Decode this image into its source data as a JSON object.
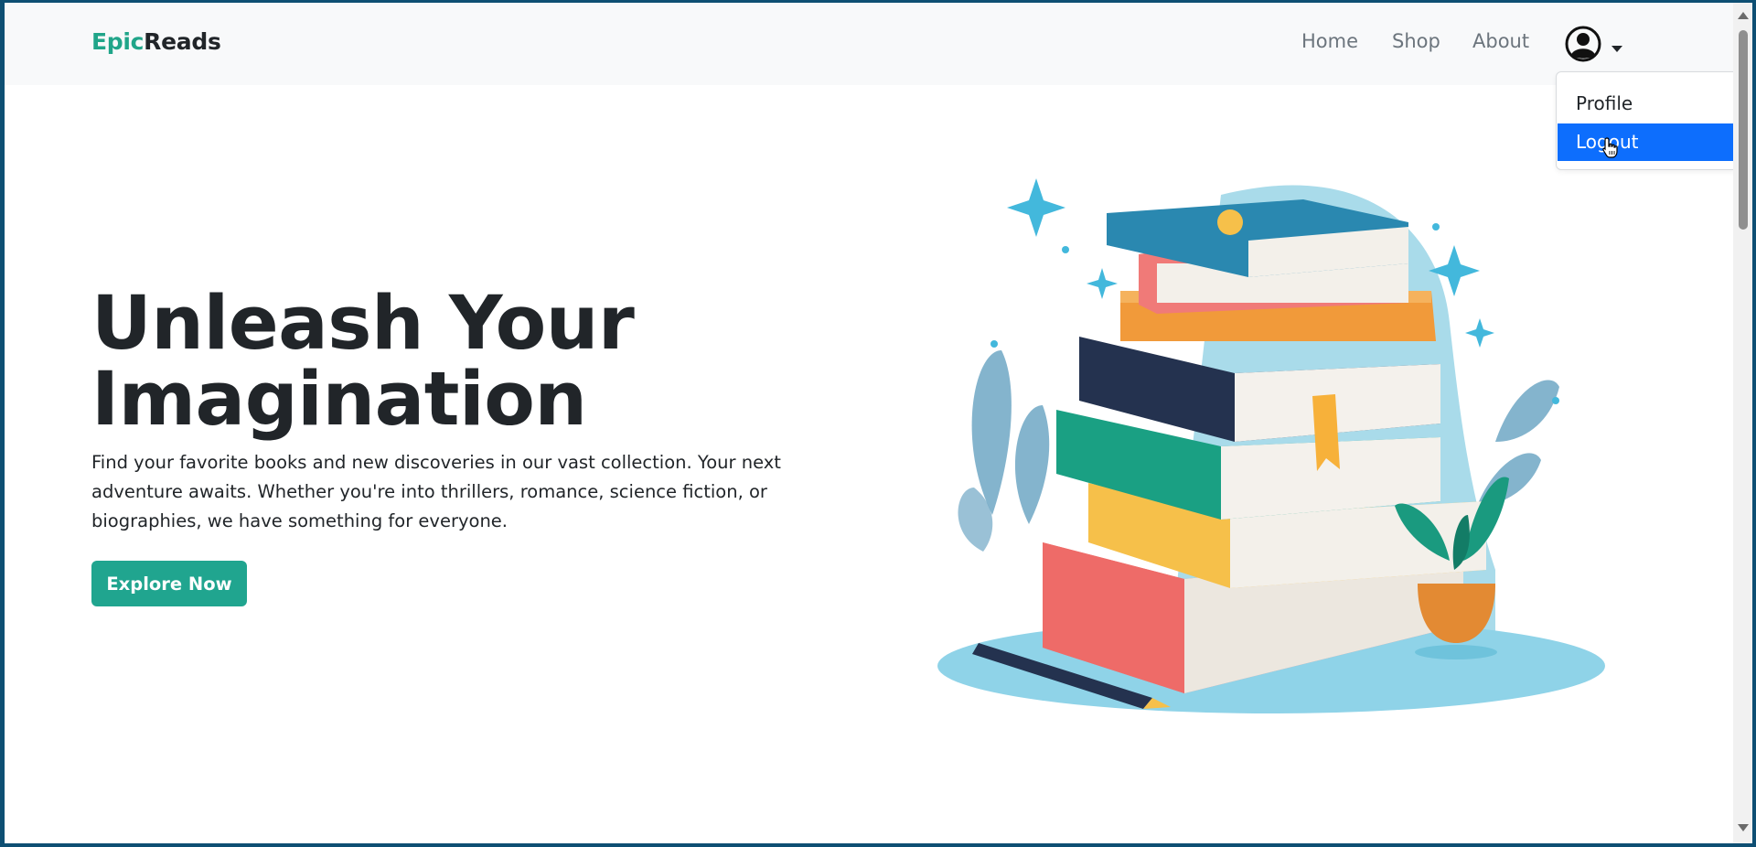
{
  "brand": {
    "part1": "Epic",
    "part2": "Reads"
  },
  "nav": {
    "home": "Home",
    "shop": "Shop",
    "about": "About"
  },
  "user_menu": {
    "items": [
      "Profile",
      "Logout"
    ],
    "highlighted": "Logout"
  },
  "hero": {
    "title_line1": "Unleash Your",
    "title_line2": "Imagination",
    "text": "Find your favorite books and new discoveries in our vast collection. Your next adventure awaits. Whether you're into thrillers, romance, science fiction, or biographies, we have something for everyone.",
    "button": "Explore Now"
  },
  "icons": [
    "user-circle-icon",
    "caret-down-icon",
    "hand-pointer-cursor-icon"
  ],
  "colors": {
    "accent": "#20a589",
    "dropdown_active": "#0d6efd",
    "text": "#212529",
    "nav_link": "#6c757d"
  }
}
